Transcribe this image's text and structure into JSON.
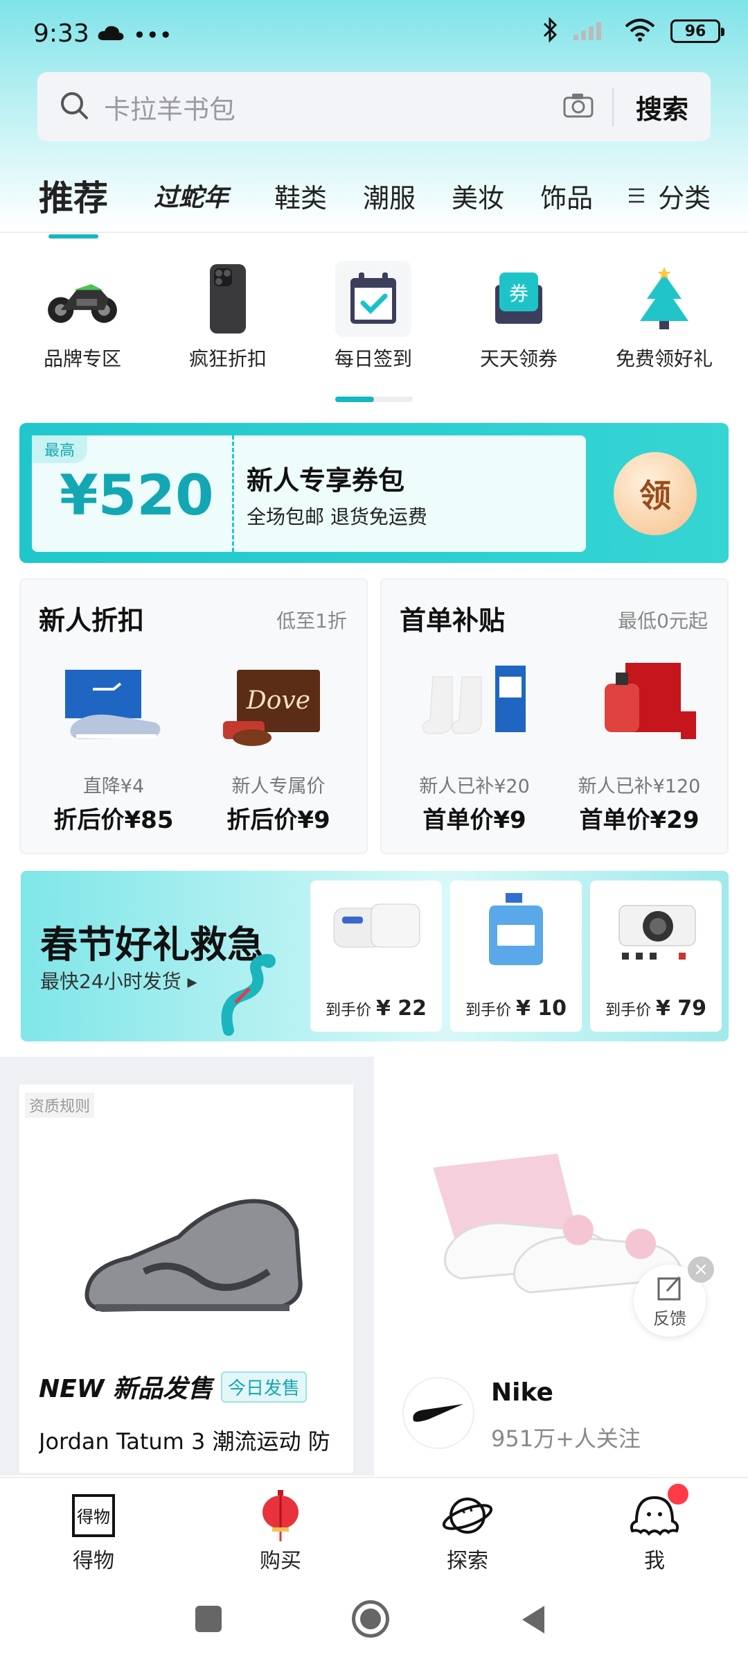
{
  "status": {
    "time": "9:33",
    "battery": "96"
  },
  "search": {
    "placeholder": "卡拉羊书包",
    "button": "搜索"
  },
  "tabs": [
    "推荐",
    "过蛇年",
    "鞋类",
    "潮服",
    "美妆",
    "饰品"
  ],
  "tabs_more": "分类",
  "shortcuts": [
    "品牌专区",
    "疯狂折扣",
    "每日签到",
    "天天领券",
    "免费领好礼"
  ],
  "coupon": {
    "top_tag": "最高",
    "amount": "¥520",
    "title": "新人专享券包",
    "subtitle": "全场包邮 退货免运费",
    "claim": "领"
  },
  "card_left": {
    "title": "新人折扣",
    "subtitle": "低至1折",
    "items": [
      {
        "sub": "直降¥4",
        "price": "折后价¥85"
      },
      {
        "sub": "新人专属价",
        "price": "折后价¥9"
      }
    ]
  },
  "card_right": {
    "title": "首单补贴",
    "subtitle": "最低0元起",
    "items": [
      {
        "sub": "新人已补¥20",
        "price": "首单价¥9"
      },
      {
        "sub": "新人已补¥120",
        "price": "首单价¥29"
      }
    ]
  },
  "spring": {
    "title": "春节好礼救急",
    "subtitle": "最快24小时发货 ▸",
    "items": [
      {
        "label": "到手价",
        "price": "¥ 22"
      },
      {
        "label": "到手价",
        "price": "¥ 10"
      },
      {
        "label": "到手价",
        "price": "¥ 79"
      }
    ]
  },
  "feed_left": {
    "tag": "资质规则",
    "new_label": "NEW 新品发售",
    "badge": "今日发售",
    "title": "Jordan Tatum 3 潮流运动 防"
  },
  "feed_right": {
    "brand": "Nike",
    "followers": "951万+人关注",
    "feedback": "反馈"
  },
  "bottom_nav": [
    "得物",
    "购买",
    "探索",
    "我"
  ],
  "colors": {
    "accent": "#16b6c2",
    "badge_red": "#ff3b47"
  }
}
